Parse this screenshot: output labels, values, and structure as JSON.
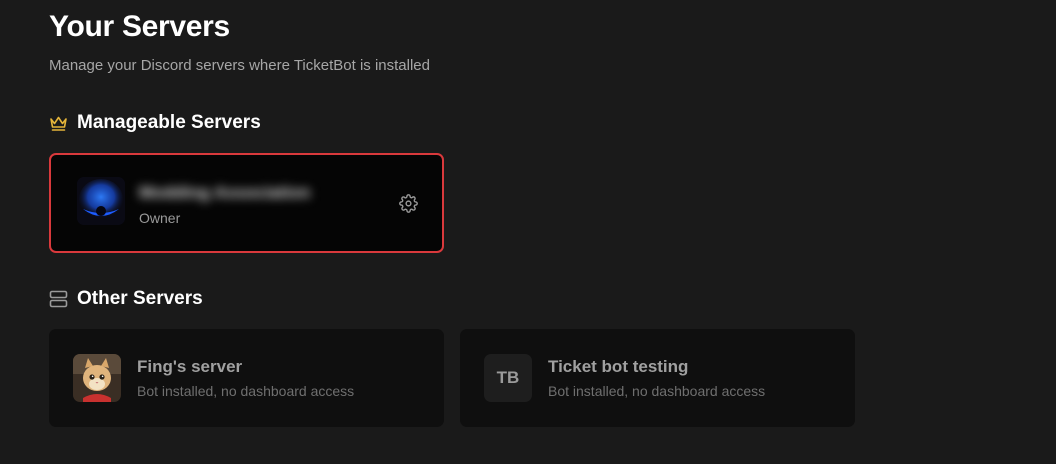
{
  "page": {
    "title": "Your Servers",
    "subtitle": "Manage your Discord servers where TicketBot is installed"
  },
  "manageable": {
    "heading": "Manageable Servers",
    "icon": "crown-icon",
    "accent_color": "#e6b53a",
    "servers": [
      {
        "name": "Modding Association",
        "role": "Owner",
        "border_color": "#d9393c",
        "action_icon": "gear-icon"
      }
    ]
  },
  "other": {
    "heading": "Other Servers",
    "icon": "server-stack-icon",
    "servers": [
      {
        "name": "Fing's server",
        "status": "Bot installed, no dashboard access",
        "avatar": "cat-photo"
      },
      {
        "name": "Ticket bot testing",
        "status": "Bot installed, no dashboard access",
        "initials": "TB"
      }
    ]
  }
}
